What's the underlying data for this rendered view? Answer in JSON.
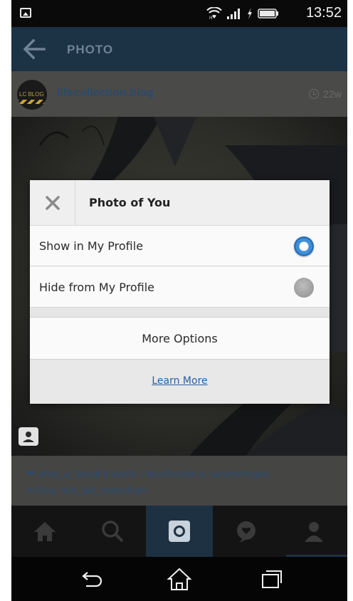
{
  "status_bar": {
    "time": "13:52",
    "icons": [
      "image-notification-icon",
      "wifi-icon",
      "signal-icon",
      "charging-icon",
      "battery-icon"
    ]
  },
  "app_bar": {
    "title": "PHOTO",
    "back_icon": "back-arrow-icon"
  },
  "post": {
    "avatar_text": "LC BLOG",
    "username": "lifecollection.blog",
    "time_ago": "22w",
    "likes_line1": "what_a_beautifulworld, lifecollection.ir, saramehrgan,",
    "likes_line2": "m3lixx, rich_kid_snapchats"
  },
  "dialog": {
    "title": "Photo of You",
    "options": [
      {
        "label": "Show in My Profile",
        "selected": true
      },
      {
        "label": "Hide from My Profile",
        "selected": false
      }
    ],
    "more_options": "More Options",
    "learn_more": "Learn More"
  },
  "tab_bar": {
    "tabs": [
      "home-icon",
      "search-icon",
      "camera-icon",
      "activity-icon",
      "profile-icon"
    ],
    "active_tab": "camera-icon"
  },
  "android_nav": [
    "back-icon",
    "home-icon",
    "recents-icon"
  ],
  "colors": {
    "accent_blue": "#3f8fd6",
    "app_bar": "#1c3245",
    "link": "#2a5fa0"
  }
}
